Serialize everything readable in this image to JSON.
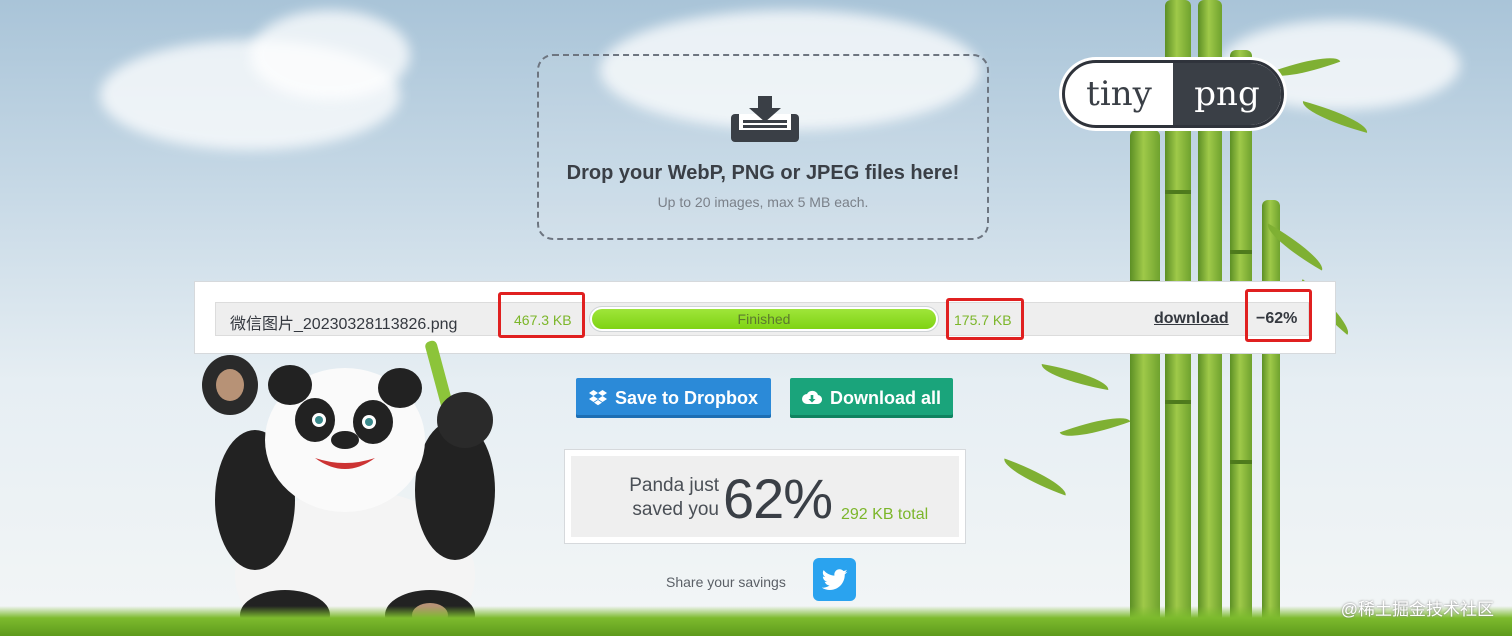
{
  "logo": {
    "part1": "tiny",
    "part2": "png"
  },
  "dropzone": {
    "title": "Drop your WebP, PNG or JPEG files here!",
    "subtitle": "Up to 20 images, max 5 MB each.",
    "icon": "download-tray-icon"
  },
  "result": {
    "filename": "微信图片_20230328113826.png",
    "original_size": "467.3 KB",
    "status": "Finished",
    "progress_fraction": 1.0,
    "compressed_size": "175.7 KB",
    "download_label": "download",
    "reduction": "−62%"
  },
  "actions": {
    "dropbox_label": "Save to Dropbox",
    "dropbox_icon": "dropbox-icon",
    "download_all_label": "Download all",
    "download_all_icon": "cloud-download-icon"
  },
  "savings": {
    "label_line1": "Panda just",
    "label_line2": "saved you",
    "percent": "62%",
    "total": "292 KB total"
  },
  "share": {
    "text": "Share your savings",
    "icon": "twitter-icon"
  },
  "watermark": "@稀土掘金技术社区",
  "colors": {
    "accent_green": "#7cb62a",
    "dropbox_blue": "#2b8ad8",
    "download_green": "#1aa47b",
    "twitter_blue": "#2aa3ef",
    "highlight_red": "#e02020"
  }
}
